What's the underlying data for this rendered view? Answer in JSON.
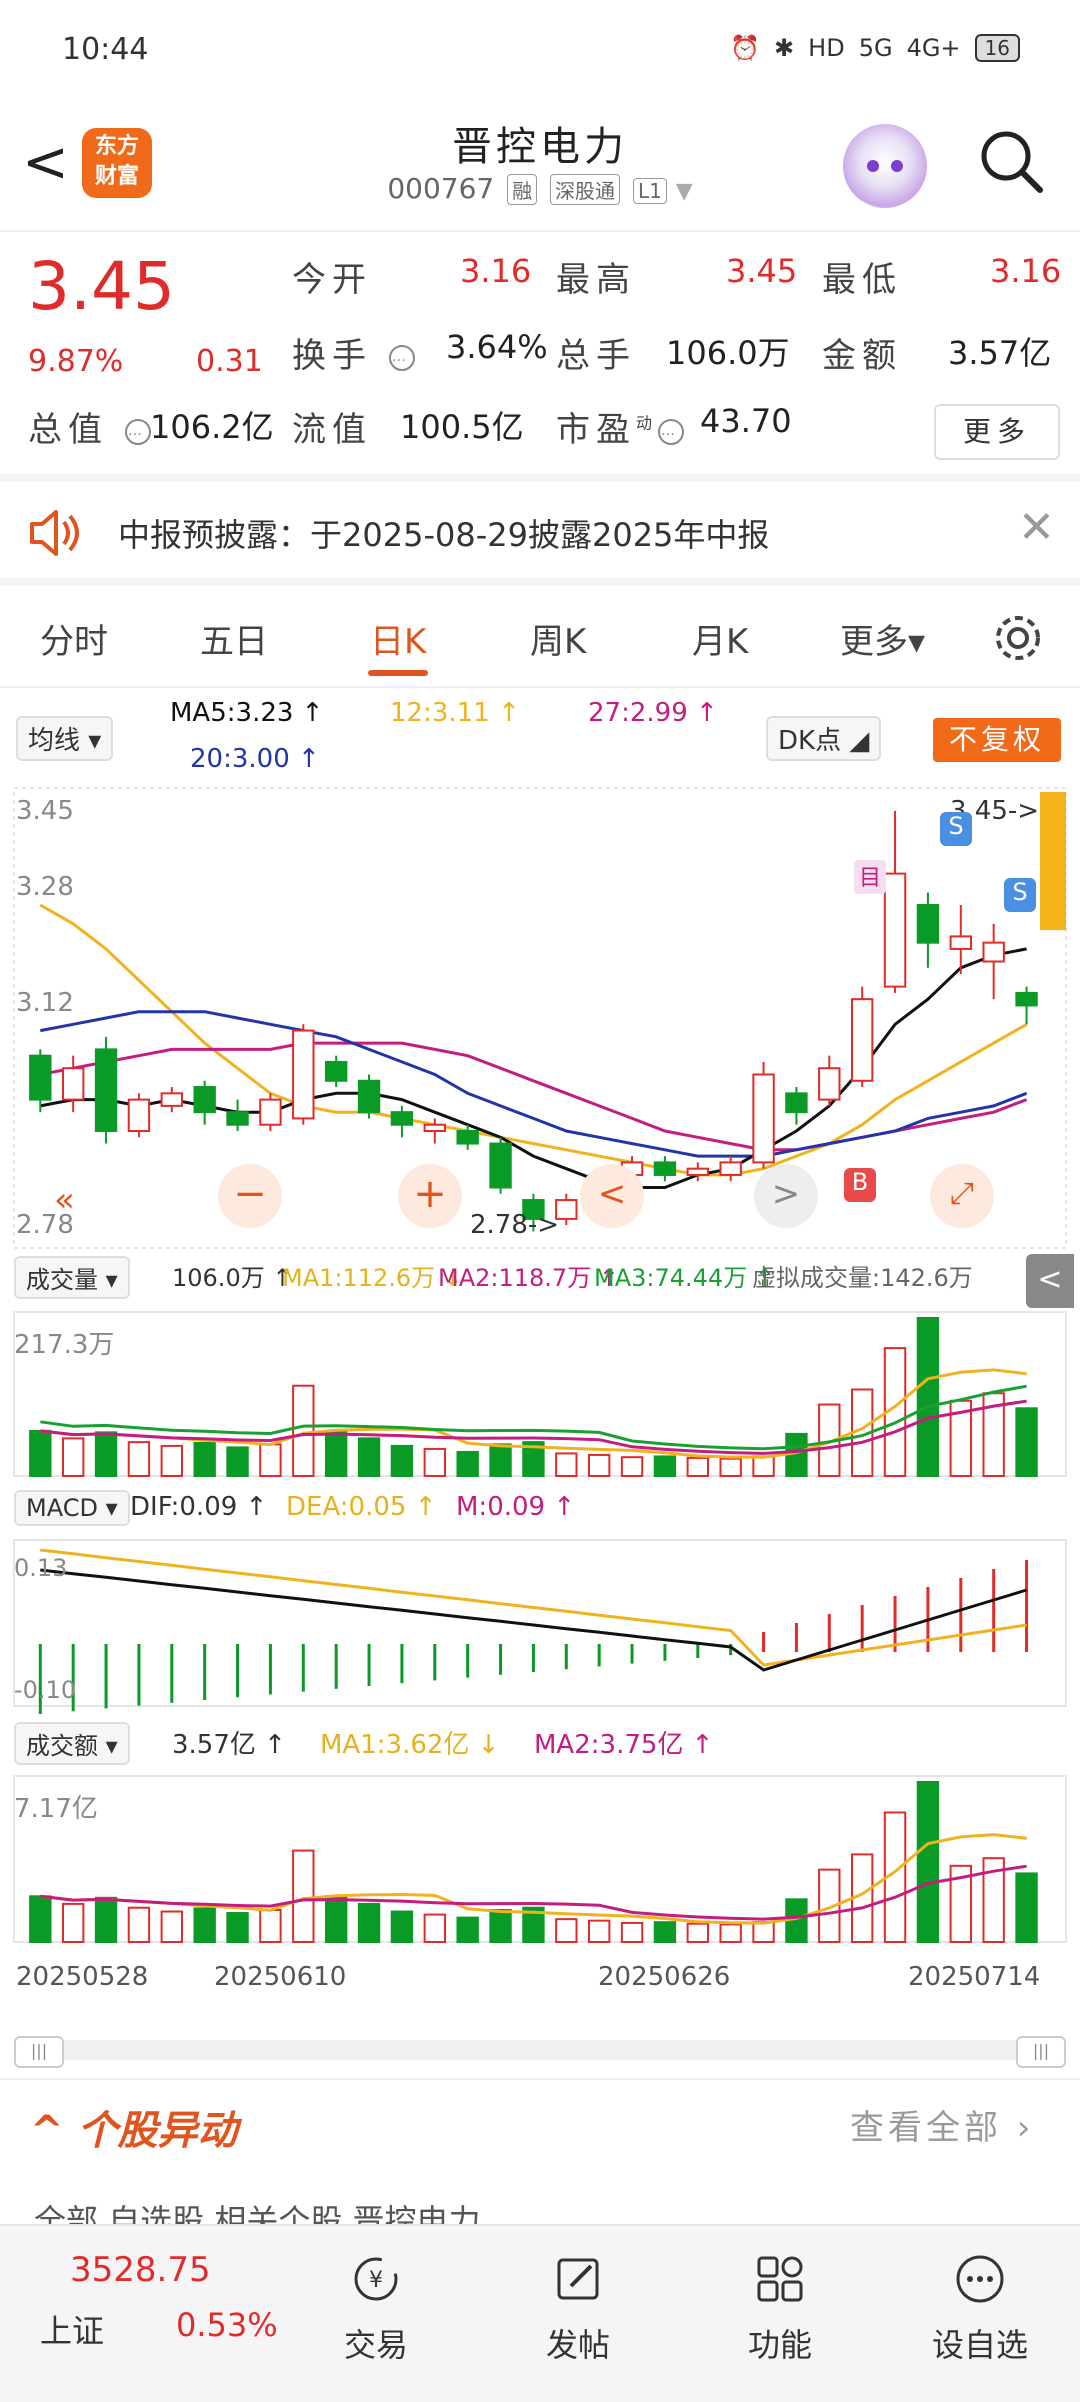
{
  "status_bar": {
    "time": "10:44",
    "battery": "16",
    "signal_5g": "5G",
    "signal_4g": "4G+",
    "hd": "HD"
  },
  "header": {
    "back_glyph": "<",
    "logo_line1": "东方",
    "logo_line2": "财富",
    "stock_name": "晋控电力",
    "stock_code": "000767",
    "tags": [
      "融",
      "深股通",
      "L1"
    ]
  },
  "quote": {
    "price": "3.45",
    "change_pct": "9.87%",
    "change": "0.31",
    "open_label": "今开",
    "open": "3.16",
    "high_label": "最高",
    "high": "3.45",
    "low_label": "最低",
    "low": "3.16",
    "turnover_label": "换手",
    "turnover": "3.64%",
    "volume_label": "总手",
    "volume": "106.0万",
    "amount_label": "金额",
    "amount": "3.57亿",
    "total_cap_label": "总值",
    "total_cap": "106.2亿",
    "float_cap_label": "流值",
    "float_cap": "100.5亿",
    "pe_label": "市盈",
    "pe_sup": "动",
    "pe": "43.70",
    "more_label": "更多"
  },
  "notice": {
    "text": "中报预披露：于2025-08-29披露2025年中报"
  },
  "tabs": [
    {
      "label": "分时"
    },
    {
      "label": "五日"
    },
    {
      "label": "日K"
    },
    {
      "label": "周K"
    },
    {
      "label": "月K"
    },
    {
      "label": "更多▾"
    }
  ],
  "chart_controls": {
    "ma_select": "均线",
    "ma5": "MA5:3.23 ↑",
    "ma12": "12:3.11 ↑",
    "ma27": "27:2.99 ↑",
    "ma20": "20:3.00 ↑",
    "dk_label": "DK点",
    "fuquan": "不复权"
  },
  "colors": {
    "up": "#e02b2b",
    "down": "#0a9a26",
    "ma5": "#111111",
    "ma12": "#f0b21e",
    "ma20": "#2234a8",
    "ma27": "#c21d7f",
    "accent": "#e0551e"
  },
  "chart_data": {
    "type": "candlestick",
    "dates_shown": [
      "20250528",
      "20250610",
      "20250626",
      "20250714"
    ],
    "price_axis": {
      "top": "3.45",
      "mid1": "3.28",
      "mid2": "3.12",
      "bottom": "2.78"
    },
    "price_ylim": [
      2.76,
      3.48
    ],
    "candles": [
      {
        "o": 3.06,
        "c": 2.99,
        "h": 3.07,
        "l": 2.97
      },
      {
        "o": 2.99,
        "c": 3.04,
        "h": 3.06,
        "l": 2.97
      },
      {
        "o": 3.07,
        "c": 2.94,
        "h": 3.09,
        "l": 2.92
      },
      {
        "o": 2.94,
        "c": 2.99,
        "h": 3.0,
        "l": 2.93
      },
      {
        "o": 2.98,
        "c": 3.0,
        "h": 3.01,
        "l": 2.97
      },
      {
        "o": 3.01,
        "c": 2.97,
        "h": 3.02,
        "l": 2.95
      },
      {
        "o": 2.97,
        "c": 2.95,
        "h": 2.99,
        "l": 2.94
      },
      {
        "o": 2.95,
        "c": 2.99,
        "h": 3.0,
        "l": 2.94
      },
      {
        "o": 2.96,
        "c": 3.1,
        "h": 3.11,
        "l": 2.95
      },
      {
        "o": 3.05,
        "c": 3.02,
        "h": 3.06,
        "l": 3.01
      },
      {
        "o": 3.02,
        "c": 2.97,
        "h": 3.03,
        "l": 2.96
      },
      {
        "o": 2.97,
        "c": 2.95,
        "h": 2.98,
        "l": 2.93
      },
      {
        "o": 2.94,
        "c": 2.95,
        "h": 2.96,
        "l": 2.92
      },
      {
        "o": 2.94,
        "c": 2.92,
        "h": 2.95,
        "l": 2.91
      },
      {
        "o": 2.92,
        "c": 2.85,
        "h": 2.93,
        "l": 2.84
      },
      {
        "o": 2.83,
        "c": 2.8,
        "h": 2.84,
        "l": 2.78
      },
      {
        "o": 2.8,
        "c": 2.83,
        "h": 2.84,
        "l": 2.79
      },
      {
        "o": 2.83,
        "c": 2.87,
        "h": 2.88,
        "l": 2.82
      },
      {
        "o": 2.87,
        "c": 2.89,
        "h": 2.9,
        "l": 2.86
      },
      {
        "o": 2.89,
        "c": 2.87,
        "h": 2.9,
        "l": 2.86
      },
      {
        "o": 2.87,
        "c": 2.88,
        "h": 2.89,
        "l": 2.86
      },
      {
        "o": 2.87,
        "c": 2.89,
        "h": 2.9,
        "l": 2.86
      },
      {
        "o": 2.89,
        "c": 3.03,
        "h": 3.05,
        "l": 2.88
      },
      {
        "o": 3.0,
        "c": 2.97,
        "h": 3.01,
        "l": 2.95
      },
      {
        "o": 2.99,
        "c": 3.04,
        "h": 3.06,
        "l": 2.98
      },
      {
        "o": 3.02,
        "c": 3.15,
        "h": 3.17,
        "l": 3.01
      },
      {
        "o": 3.17,
        "c": 3.35,
        "h": 3.45,
        "l": 3.16
      },
      {
        "o": 3.3,
        "c": 3.24,
        "h": 3.32,
        "l": 3.2
      },
      {
        "o": 3.23,
        "c": 3.25,
        "h": 3.3,
        "l": 3.19
      },
      {
        "o": 3.21,
        "c": 3.24,
        "h": 3.27,
        "l": 3.15
      },
      {
        "o": 3.16,
        "c": 3.14,
        "h": 3.17,
        "l": 3.11
      }
    ],
    "ma5": [
      2.98,
      2.99,
      2.99,
      2.98,
      2.99,
      2.98,
      2.97,
      2.97,
      2.99,
      3.0,
      3.0,
      2.99,
      2.97,
      2.95,
      2.93,
      2.9,
      2.88,
      2.86,
      2.85,
      2.85,
      2.87,
      2.88,
      2.91,
      2.94,
      2.98,
      3.04,
      3.11,
      3.15,
      3.2,
      3.22,
      3.23
    ],
    "ma12": [
      3.3,
      3.27,
      3.23,
      3.18,
      3.13,
      3.08,
      3.04,
      3.0,
      2.98,
      2.97,
      2.97,
      2.96,
      2.95,
      2.94,
      2.93,
      2.92,
      2.91,
      2.9,
      2.89,
      2.88,
      2.87,
      2.87,
      2.88,
      2.9,
      2.92,
      2.95,
      2.99,
      3.02,
      3.05,
      3.08,
      3.11
    ],
    "ma20": [
      3.1,
      3.11,
      3.12,
      3.13,
      3.13,
      3.13,
      3.12,
      3.11,
      3.1,
      3.09,
      3.07,
      3.05,
      3.03,
      3.0,
      2.98,
      2.96,
      2.94,
      2.93,
      2.92,
      2.91,
      2.9,
      2.9,
      2.9,
      2.91,
      2.92,
      2.93,
      2.94,
      2.96,
      2.97,
      2.98,
      3.0
    ],
    "ma27": [
      3.03,
      3.04,
      3.05,
      3.06,
      3.07,
      3.07,
      3.07,
      3.07,
      3.08,
      3.08,
      3.08,
      3.08,
      3.07,
      3.06,
      3.04,
      3.02,
      3.0,
      2.98,
      2.96,
      2.94,
      2.93,
      2.92,
      2.91,
      2.91,
      2.92,
      2.93,
      2.94,
      2.95,
      2.96,
      2.97,
      2.99
    ],
    "volume_label": "成交量",
    "volume_value": "106.0万 ↑",
    "vol_ma1": "MA1:112.6万 ↓",
    "vol_ma2": "MA2:118.7万 ↑",
    "vol_ma3": "MA3:74.44万 ↑",
    "vol_virtual": "虚拟成交量:142.6万",
    "volume_max": "217.3万",
    "volumes": [
      60,
      50,
      58,
      45,
      40,
      44,
      38,
      42,
      120,
      60,
      50,
      40,
      36,
      32,
      42,
      45,
      30,
      28,
      25,
      26,
      24,
      23,
      26,
      56,
      95,
      115,
      170,
      210,
      100,
      110,
      90,
      98
    ],
    "macd_label": "MACD",
    "dif": "DIF:0.09 ↑",
    "dea": "DEA:0.05 ↑",
    "m": "M:0.09 ↑",
    "macd_top": "0.13",
    "macd_bottom": "-0.10",
    "amount_label": "成交额",
    "amount_value": "3.57亿 ↑",
    "amt_ma1": "MA1:3.62亿 ↓",
    "amt_ma2": "MA2:3.75亿 ↑",
    "amount_max": "7.17亿",
    "markers": {
      "sell": "S",
      "buy": "B",
      "target": "目",
      "price_arrow": "3.45->",
      "low_label": "2.78->"
    }
  },
  "anomaly": {
    "title": "个股异动",
    "view_all": "查看全部",
    "sub_tabs": "全部   自选股   相关个股   晋控电力"
  },
  "bottom_bar": {
    "index_value": "3528.75",
    "index_name": "上证",
    "index_pct": "0.53%",
    "trade": "交易",
    "post": "发帖",
    "func": "功能",
    "watch": "设自选"
  }
}
